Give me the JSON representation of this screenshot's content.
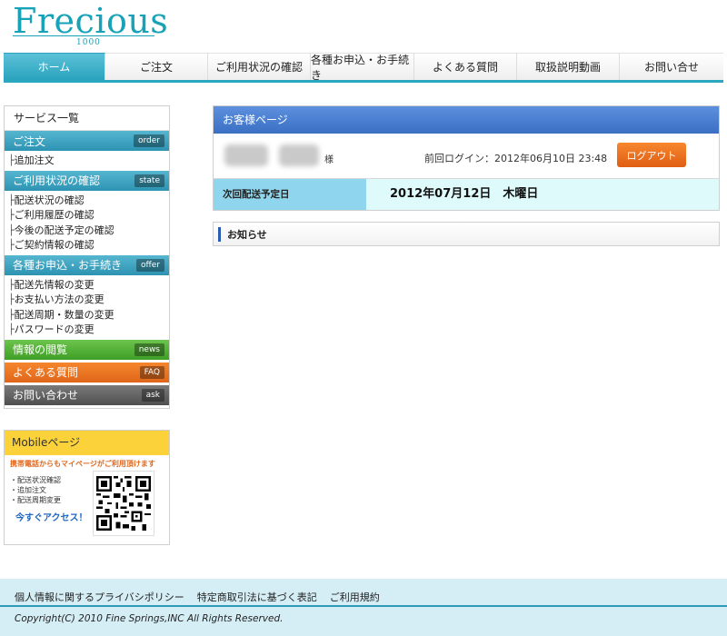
{
  "logo": {
    "main": "Frecious",
    "sub": "1000"
  },
  "colors": {
    "accent": "#2aa6bf",
    "panel_head": "#3a6fc4",
    "logout": "#e05e14",
    "mobile": "#fbd23a"
  },
  "gnav": [
    {
      "label": "ホーム",
      "active": true
    },
    {
      "label": "ご注文"
    },
    {
      "label": "ご利用状況の確認"
    },
    {
      "label": "各種お申込・お手続き"
    },
    {
      "label": "よくある質問"
    },
    {
      "label": "取扱説明動画"
    },
    {
      "label": "お問い合せ"
    }
  ],
  "sidebar": {
    "title": "サービス一覧",
    "order": {
      "label": "ご注文",
      "tag": "order",
      "items": [
        "追加注文"
      ]
    },
    "state": {
      "label": "ご利用状況の確認",
      "tag": "state",
      "items": [
        "配送状況の確認",
        "ご利用履歴の確認",
        "今後の配送予定の確認",
        "ご契約情報の確認"
      ]
    },
    "offer": {
      "label": "各種お申込・お手続き",
      "tag": "offer",
      "items": [
        "配送先情報の変更",
        "お支払い方法の変更",
        "配送周期・数量の変更",
        "パスワードの変更"
      ]
    },
    "news": {
      "label": "情報の閲覧",
      "tag": "news"
    },
    "faq": {
      "label": "よくある質問",
      "tag": "FAQ"
    },
    "ask": {
      "label": "お問い合わせ",
      "tag": "ask"
    }
  },
  "mobile": {
    "title": "Mobileページ",
    "notice": "携帯電話からもマイページがご利用頂けます",
    "items": [
      "・配送状況確認",
      "・追加注文",
      "・配送周期変更"
    ],
    "link": "今すぐアクセス！"
  },
  "main": {
    "title": "お客様ページ",
    "sama": "様",
    "last_login": "前回ログイン：2012年06月10日 23:48",
    "logout": "ログアウト",
    "delivery_label": "次回配送予定日",
    "delivery_value": "2012年07月12日　木曜日",
    "notice": "お知らせ"
  },
  "footer": {
    "links": [
      "個人情報に関するプライバシポリシー",
      "特定商取引法に基づく表記",
      "ご利用規約"
    ],
    "copyright": "Copyright(C) 2010 Fine Springs,INC All Rights Reserved."
  }
}
